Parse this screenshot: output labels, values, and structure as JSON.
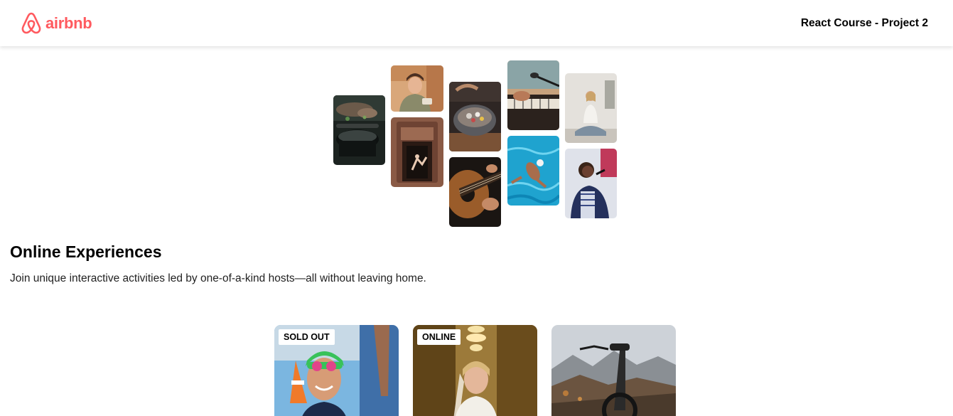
{
  "navbar": {
    "logo_text": "airbnb",
    "title": "React Course - Project 2"
  },
  "colors": {
    "brand": "#FF5A5F",
    "text": "#222222",
    "background": "#FFFFFF"
  },
  "hero": {
    "photos": [
      {
        "subject": "cooking"
      },
      {
        "subject": "woman-portrait"
      },
      {
        "subject": "dancer-doorway"
      },
      {
        "subject": "food-bowl"
      },
      {
        "subject": "guitar"
      },
      {
        "subject": "keyboard-microphone"
      },
      {
        "subject": "swimmer"
      },
      {
        "subject": "yoga"
      },
      {
        "subject": "singer"
      }
    ],
    "title": "Online Experiences",
    "text": "Join unique interactive activities led by one-of-a-kind hosts—all without leaving home."
  },
  "cards": [
    {
      "badge": "SOLD OUT",
      "subject": "swimmer-portrait"
    },
    {
      "badge": "ONLINE",
      "subject": "bride-portrait"
    },
    {
      "badge": "",
      "subject": "bike-mountains"
    }
  ]
}
